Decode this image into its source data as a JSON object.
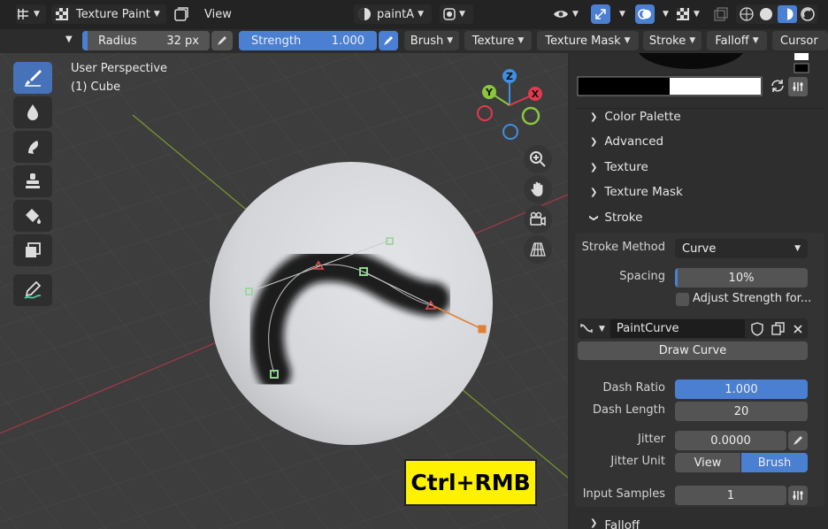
{
  "header": {
    "mode_label": "Texture Paint",
    "view_menu": "View",
    "image_name": "paintA"
  },
  "tool_settings": {
    "radius_label": "Radius",
    "radius_value": "32 px",
    "strength_label": "Strength",
    "strength_value": "1.000",
    "menus": [
      "Brush",
      "Texture",
      "Texture Mask",
      "Stroke",
      "Falloff",
      "Cursor"
    ]
  },
  "viewport": {
    "perspective": "User Perspective",
    "object": "(1) Cube",
    "gizmo_axes": [
      "Z",
      "Y",
      "X"
    ]
  },
  "shortcut_overlay": "Ctrl+RMB",
  "panel": {
    "sections": [
      "Color Palette",
      "Advanced",
      "Texture",
      "Texture Mask",
      "Stroke"
    ],
    "stroke_method_label": "Stroke Method",
    "stroke_method_value": "Curve",
    "spacing_label": "Spacing",
    "spacing_value": "10%",
    "adjust_strength_label": "Adjust Strength for...",
    "paint_curve_name": "PaintCurve",
    "draw_curve_button": "Draw Curve",
    "dash_ratio_label": "Dash Ratio",
    "dash_ratio_value": "1.000",
    "dash_length_label": "Dash Length",
    "dash_length_value": "20",
    "jitter_label": "Jitter",
    "jitter_value": "0.0000",
    "jitter_unit_label": "Jitter Unit",
    "jitter_unit_options": [
      "View",
      "Brush"
    ],
    "jitter_unit_selected": "Brush",
    "input_samples_label": "Input Samples",
    "input_samples_value": "1",
    "falloff_partial": "Falloff"
  },
  "colors": {
    "accent": "#4a7fd2",
    "overlay_yellow": "#fff200",
    "axis_x": "#e3394c",
    "axis_y": "#8bc63e",
    "axis_z": "#3f8fe3"
  }
}
